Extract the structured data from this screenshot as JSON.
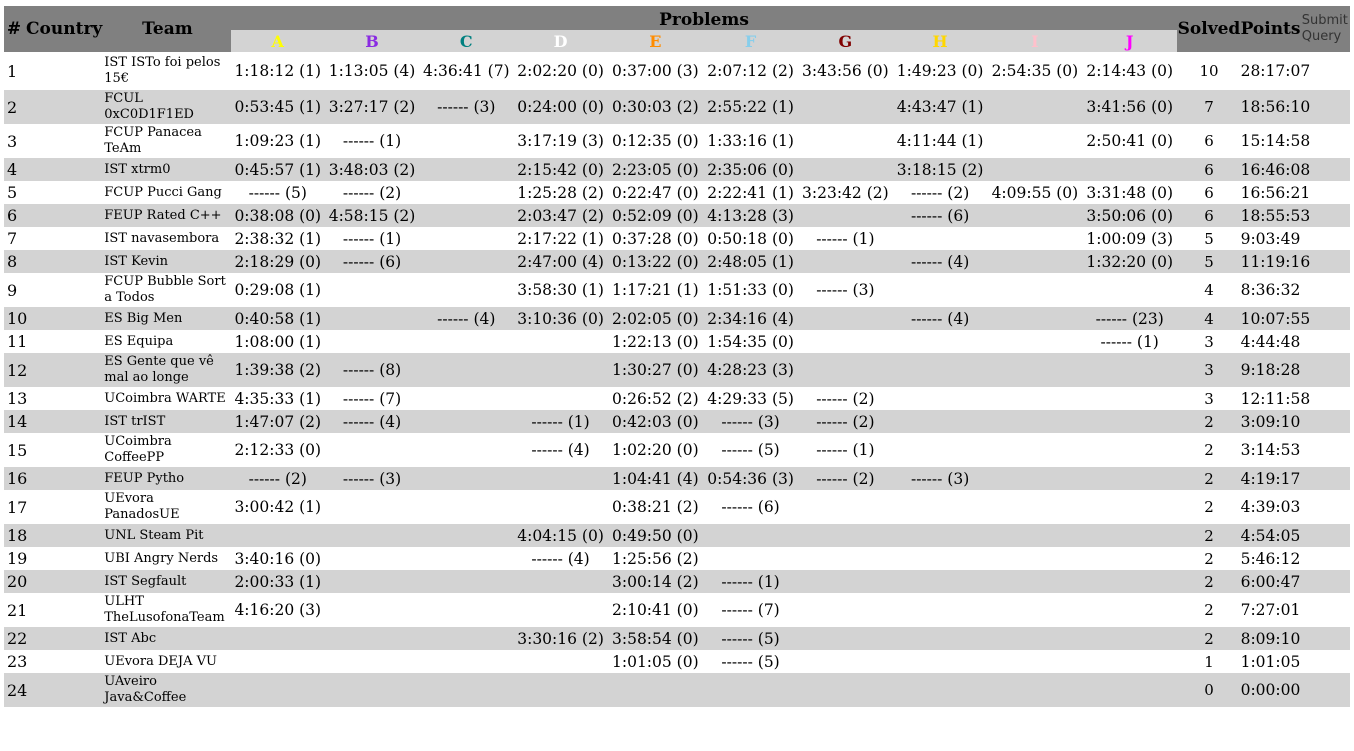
{
  "header": {
    "rank": "#",
    "country": "Country",
    "team": "Team",
    "problems": "Problems",
    "solved": "Solved",
    "points": "Points",
    "submit": "Submit",
    "query": "Query"
  },
  "problems": [
    {
      "letter": "A",
      "color": "#ffff00"
    },
    {
      "letter": "B",
      "color": "#8a2be2"
    },
    {
      "letter": "C",
      "color": "#008080"
    },
    {
      "letter": "D",
      "color": "#ffffff"
    },
    {
      "letter": "E",
      "color": "#ff8c00"
    },
    {
      "letter": "F",
      "color": "#87ceeb"
    },
    {
      "letter": "G",
      "color": "#800000"
    },
    {
      "letter": "H",
      "color": "#ffd700"
    },
    {
      "letter": "I",
      "color": "#ffc0cb"
    },
    {
      "letter": "J",
      "color": "#ff00ff"
    }
  ],
  "rows": [
    {
      "rank": "1",
      "team": "IST ISTo foi pelos 15€",
      "cells": [
        "1:18:12 (1)",
        "1:13:05 (4)",
        "4:36:41 (7)",
        "2:02:20 (0)",
        "0:37:00 (3)",
        "2:07:12 (2)",
        "3:43:56 (0)",
        "1:49:23 (0)",
        "2:54:35 (0)",
        "2:14:43 (0)"
      ],
      "solved": "10",
      "points": "28:17:07"
    },
    {
      "rank": "2",
      "team": "FCUL 0xC0D1F1ED",
      "cells": [
        "0:53:45 (1)",
        "3:27:17 (2)",
        "------ (3)",
        "0:24:00 (0)",
        "0:30:03 (2)",
        "2:55:22 (1)",
        "",
        "4:43:47 (1)",
        "",
        "3:41:56 (0)"
      ],
      "solved": "7",
      "points": "18:56:10"
    },
    {
      "rank": "3",
      "team": "FCUP Panacea TeAm",
      "cells": [
        "1:09:23 (1)",
        "------ (1)",
        "",
        "3:17:19 (3)",
        "0:12:35 (0)",
        "1:33:16 (1)",
        "",
        "4:11:44 (1)",
        "",
        "2:50:41 (0)"
      ],
      "solved": "6",
      "points": "15:14:58"
    },
    {
      "rank": "4",
      "team": "IST xtrm0",
      "cells": [
        "0:45:57 (1)",
        "3:48:03 (2)",
        "",
        "2:15:42 (0)",
        "2:23:05 (0)",
        "2:35:06 (0)",
        "",
        "3:18:15 (2)",
        "",
        ""
      ],
      "solved": "6",
      "points": "16:46:08"
    },
    {
      "rank": "5",
      "team": "FCUP Pucci Gang",
      "cells": [
        "------ (5)",
        "------ (2)",
        "",
        "1:25:28 (2)",
        "0:22:47 (0)",
        "2:22:41 (1)",
        "3:23:42 (2)",
        "------ (2)",
        "4:09:55 (0)",
        "3:31:48 (0)"
      ],
      "solved": "6",
      "points": "16:56:21"
    },
    {
      "rank": "6",
      "team": "FEUP Rated C++",
      "cells": [
        "0:38:08 (0)",
        "4:58:15 (2)",
        "",
        "2:03:47 (2)",
        "0:52:09 (0)",
        "4:13:28 (3)",
        "",
        "------ (6)",
        "",
        "3:50:06 (0)"
      ],
      "solved": "6",
      "points": "18:55:53"
    },
    {
      "rank": "7",
      "team": "IST navasembora",
      "cells": [
        "2:38:32 (1)",
        "------ (1)",
        "",
        "2:17:22 (1)",
        "0:37:28 (0)",
        "0:50:18 (0)",
        "------ (1)",
        "",
        "",
        "1:00:09 (3)"
      ],
      "solved": "5",
      "points": "9:03:49"
    },
    {
      "rank": "8",
      "team": "IST Kevin",
      "cells": [
        "2:18:29 (0)",
        "------ (6)",
        "",
        "2:47:00 (4)",
        "0:13:22 (0)",
        "2:48:05 (1)",
        "",
        "------ (4)",
        "",
        "1:32:20 (0)"
      ],
      "solved": "5",
      "points": "11:19:16"
    },
    {
      "rank": "9",
      "team": "FCUP Bubble Sort a Todos",
      "cells": [
        "0:29:08 (1)",
        "",
        "",
        "3:58:30 (1)",
        "1:17:21 (1)",
        "1:51:33 (0)",
        "------ (3)",
        "",
        "",
        ""
      ],
      "solved": "4",
      "points": "8:36:32"
    },
    {
      "rank": "10",
      "team": "ES Big Men",
      "cells": [
        "0:40:58 (1)",
        "",
        "------ (4)",
        "3:10:36 (0)",
        "2:02:05 (0)",
        "2:34:16 (4)",
        "",
        "------ (4)",
        "",
        "------ (23)"
      ],
      "solved": "4",
      "points": "10:07:55"
    },
    {
      "rank": "11",
      "team": "ES Equipa",
      "cells": [
        "1:08:00 (1)",
        "",
        "",
        "",
        "1:22:13 (0)",
        "1:54:35 (0)",
        "",
        "",
        "",
        "------ (1)"
      ],
      "solved": "3",
      "points": "4:44:48"
    },
    {
      "rank": "12",
      "team": "ES Gente que vê mal ao longe",
      "cells": [
        "1:39:38 (2)",
        "------ (8)",
        "",
        "",
        "1:30:27 (0)",
        "4:28:23 (3)",
        "",
        "",
        "",
        ""
      ],
      "solved": "3",
      "points": "9:18:28"
    },
    {
      "rank": "13",
      "team": "UCoimbra WARTE",
      "cells": [
        "4:35:33 (1)",
        "------ (7)",
        "",
        "",
        "0:26:52 (2)",
        "4:29:33 (5)",
        "------ (2)",
        "",
        "",
        ""
      ],
      "solved": "3",
      "points": "12:11:58"
    },
    {
      "rank": "14",
      "team": "IST trIST",
      "cells": [
        "1:47:07 (2)",
        "------ (4)",
        "",
        "------ (1)",
        "0:42:03 (0)",
        "------ (3)",
        "------ (2)",
        "",
        "",
        ""
      ],
      "solved": "2",
      "points": "3:09:10"
    },
    {
      "rank": "15",
      "team": "UCoimbra CoffeePP",
      "cells": [
        "2:12:33 (0)",
        "",
        "",
        "------ (4)",
        "1:02:20 (0)",
        "------ (5)",
        "------ (1)",
        "",
        "",
        ""
      ],
      "solved": "2",
      "points": "3:14:53"
    },
    {
      "rank": "16",
      "team": "FEUP Pytho",
      "cells": [
        "------ (2)",
        "------ (3)",
        "",
        "",
        "1:04:41 (4)",
        "0:54:36 (3)",
        "------ (2)",
        "------ (3)",
        "",
        ""
      ],
      "solved": "2",
      "points": "4:19:17"
    },
    {
      "rank": "17",
      "team": "UEvora PanadosUE",
      "cells": [
        "3:00:42 (1)",
        "",
        "",
        "",
        "0:38:21 (2)",
        "------ (6)",
        "",
        "",
        "",
        ""
      ],
      "solved": "2",
      "points": "4:39:03"
    },
    {
      "rank": "18",
      "team": "UNL Steam Pit",
      "cells": [
        "",
        "",
        "",
        "4:04:15 (0)",
        "0:49:50 (0)",
        "",
        "",
        "",
        "",
        ""
      ],
      "solved": "2",
      "points": "4:54:05"
    },
    {
      "rank": "19",
      "team": "UBI Angry Nerds",
      "cells": [
        "3:40:16 (0)",
        "",
        "",
        "------ (4)",
        "1:25:56 (2)",
        "",
        "",
        "",
        "",
        ""
      ],
      "solved": "2",
      "points": "5:46:12"
    },
    {
      "rank": "20",
      "team": "IST Segfault",
      "cells": [
        "2:00:33 (1)",
        "",
        "",
        "",
        "3:00:14 (2)",
        "------ (1)",
        "",
        "",
        "",
        ""
      ],
      "solved": "2",
      "points": "6:00:47"
    },
    {
      "rank": "21",
      "team": "ULHT TheLusofonaTeam",
      "cells": [
        "4:16:20 (3)",
        "",
        "",
        "",
        "2:10:41 (0)",
        "------ (7)",
        "",
        "",
        "",
        ""
      ],
      "solved": "2",
      "points": "7:27:01"
    },
    {
      "rank": "22",
      "team": "IST Abc",
      "cells": [
        "",
        "",
        "",
        "3:30:16 (2)",
        "3:58:54 (0)",
        "------ (5)",
        "",
        "",
        "",
        ""
      ],
      "solved": "2",
      "points": "8:09:10"
    },
    {
      "rank": "23",
      "team": "UEvora DEJA VU",
      "cells": [
        "",
        "",
        "",
        "",
        "1:01:05 (0)",
        "------ (5)",
        "",
        "",
        "",
        ""
      ],
      "solved": "1",
      "points": "1:01:05"
    },
    {
      "rank": "24",
      "team": "UAveiro Java&Coffee",
      "cells": [
        "",
        "",
        "",
        "",
        "",
        "",
        "",
        "",
        "",
        ""
      ],
      "solved": "0",
      "points": "0:00:00"
    }
  ]
}
